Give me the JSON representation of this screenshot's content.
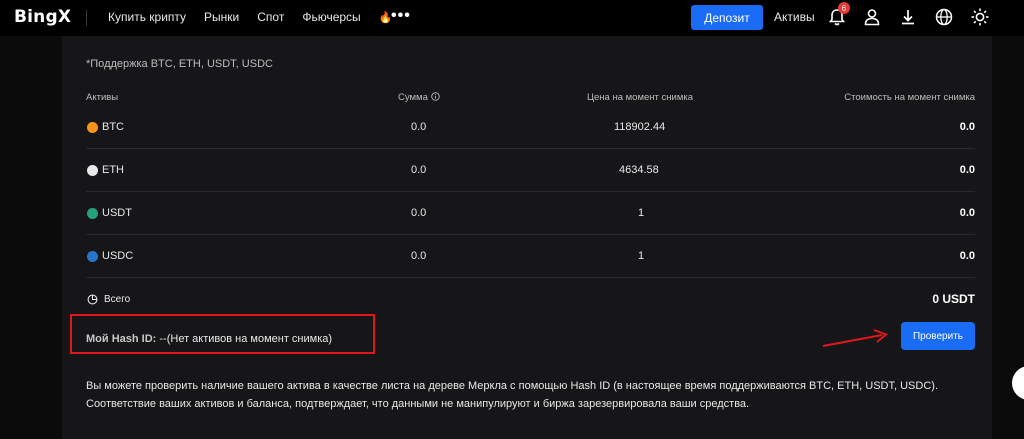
{
  "header": {
    "logo": "BingX",
    "nav": [
      "Купить крипту",
      "Рынки",
      "Спот",
      "Фьючерсы"
    ],
    "more_icon": "more-dots-icon",
    "deposit_label": "Депозит",
    "assets_label": "Активы",
    "notification_count": "6",
    "icons": [
      "bell-icon",
      "user-icon",
      "download-icon",
      "globe-icon",
      "sun-icon"
    ]
  },
  "panel": {
    "support_note": "*Поддержка BTC, ETH, USDT, USDC",
    "columns": {
      "asset": "Активы",
      "amount": "Сумма",
      "price": "Цена на момент снимка",
      "value": "Стоимость на момент снимка"
    },
    "rows": [
      {
        "asset": "BTC",
        "amount": "0.0",
        "price": "118902.44",
        "value": "0.0",
        "color": "#f7931a"
      },
      {
        "asset": "ETH",
        "amount": "0.0",
        "price": "4634.58",
        "value": "0.0",
        "color": "#e8e8e8"
      },
      {
        "asset": "USDT",
        "amount": "0.0",
        "price": "1",
        "value": "0.0",
        "color": "#26a17b"
      },
      {
        "asset": "USDC",
        "amount": "0.0",
        "price": "1",
        "value": "0.0",
        "color": "#2775ca"
      }
    ],
    "total_label": "Всего",
    "total_value": "0 USDT",
    "hash_label": "Мой Hash ID:",
    "hash_value": "--(Нет активов на момент снимка)",
    "verify_label": "Проверить",
    "description": "Вы можете проверить наличие вашего актива в качестве листа на дереве Меркла с помощью Hash ID (в настоящее время поддерживаются BTC, ETH, USDT, USDC). Соответствие ваших активов и баланса, подтверждает, что данными не манипулируют и биржа зарезервировала ваши средства."
  },
  "colors": {
    "accent": "#1a6cf5",
    "highlight": "#e0171c",
    "background": "#0b0b0c",
    "panel": "#161618"
  }
}
